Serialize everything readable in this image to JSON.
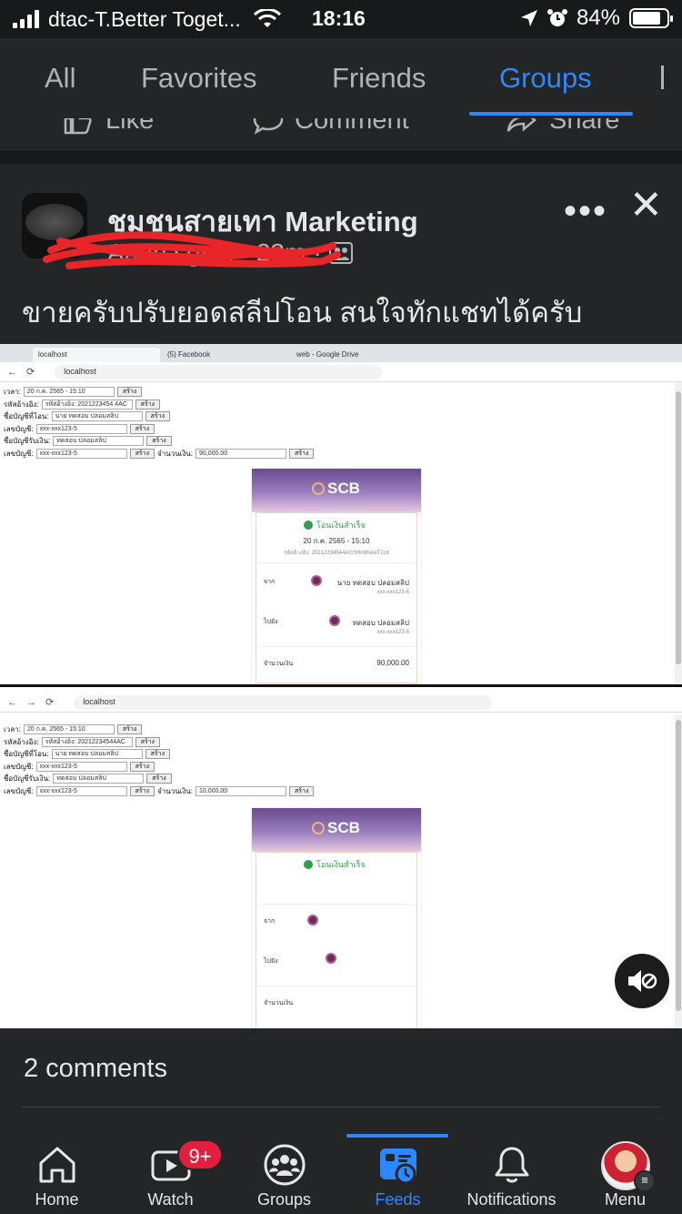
{
  "status_bar": {
    "carrier": "dtac-T.Better Toget...",
    "time": "18:16",
    "battery": "84%",
    "battery_level": 0.84
  },
  "feed_tabs": [
    {
      "label": "All"
    },
    {
      "label": "Favorites"
    },
    {
      "label": "Friends"
    },
    {
      "label": "Groups",
      "active": true
    }
  ],
  "previous_post": {
    "like": "Like",
    "comment": "Comment",
    "share": "Share"
  },
  "post": {
    "group_name": "ชุมชนสายเทา Marketing",
    "author": "Anon sgsiri",
    "time_ago": "23m",
    "separator": "·",
    "text": "ขายครับปรับยอดสลีปโอน สนใจทักแชทได้ครับ"
  },
  "screenshot": {
    "browser1": {
      "tabs": [
        "localhost",
        "(5) Facebook",
        "web - Google Drive"
      ],
      "url": "localhost",
      "form_rows": [
        {
          "label": "เวลา:",
          "value": "20 ก.ค. 2565 - 15:10",
          "button": "สร้าง"
        },
        {
          "label": "รหัสอ้างอิง:",
          "value": "รหัสอ้างอิง: 2021223454 4AC",
          "button": "สร้าง"
        },
        {
          "label": "ชื่อบัญชีที่โอน:",
          "value": "นาย ทดสอบ ปลอมสลิป",
          "button": "สร้าง"
        },
        {
          "label": "เลขบัญชี:",
          "value": "xxx-xxx123-5",
          "button": "สร้าง"
        },
        {
          "label": "ชื่อบัญชีรับเงิน:",
          "value": "ทดสอบ ปลอมสลิป",
          "button": "สร้าง"
        },
        {
          "label": "เลขบัญชี:",
          "value": "xxx-xxx123-5",
          "button": "สร้าง",
          "extra_label": "จำนวนเงิน:",
          "extra_value": "90,000.00",
          "extra_button": "สร้าง"
        }
      ],
      "slip": {
        "bank": "SCB",
        "status": "โอนเงินสำเร็จ",
        "datetime": "20 ก.ค. 2565 - 15:10",
        "ref": "รหัสอ้างอิง: 20212234544AGSHn6KewT2cb",
        "from_label": "จาก",
        "from_name": "นาย ทดสอบ ปลอมสลิป",
        "from_acct": "xxx-xxx123-5",
        "to_label": "ไปยัง",
        "to_name": "ทดสอบ ปลอมสลิป",
        "to_acct": "xxx-xxx123-5",
        "amount_label": "จำนวนเงิน",
        "amount": "90,000.00"
      }
    },
    "browser2": {
      "url": "localhost",
      "form_rows": [
        {
          "label": "เวลา:",
          "value": "20 ก.ค. 2565 - 15:10",
          "button": "สร้าง"
        },
        {
          "label": "รหัสอ้างอิง:",
          "value": "รหัสอ้างอิง: 20212234544AC",
          "button": "สร้าง"
        },
        {
          "label": "ชื่อบัญชีที่โอน:",
          "value": "นาย ทดสอบ ปลอมสลิป",
          "button": "สร้าง"
        },
        {
          "label": "เลขบัญชี:",
          "value": "xxx-xxx123-5",
          "button": "สร้าง"
        },
        {
          "label": "ชื่อบัญชีรับเงิน:",
          "value": "ทดสอบ ปลอมสลิป",
          "button": "สร้าง"
        },
        {
          "label": "เลขบัญชี:",
          "value": "xxx-xxx123-5",
          "button": "สร้าง",
          "extra_label": "จำนวนเงิน:",
          "extra_value": "10,000.00",
          "extra_button": "สร้าง"
        }
      ],
      "slip": {
        "bank": "SCB",
        "status": "โอนเงินสำเร็จ",
        "from_label": "จาก",
        "to_label": "ไปยัง",
        "amount_label": "จำนวนเงิน"
      }
    }
  },
  "comments_count": "2 comments",
  "bottom_nav": [
    {
      "label": "Home",
      "icon": "home-icon"
    },
    {
      "label": "Watch",
      "icon": "watch-icon",
      "badge": "9+"
    },
    {
      "label": "Groups",
      "icon": "groups-icon"
    },
    {
      "label": "Feeds",
      "icon": "feeds-icon",
      "active": true
    },
    {
      "label": "Notifications",
      "icon": "bell-icon"
    },
    {
      "label": "Menu",
      "icon": "profile-avatar"
    }
  ],
  "colors": {
    "accent": "#2d88ff",
    "badge": "#e41e3f",
    "background": "#18191a",
    "surface": "#242526"
  }
}
